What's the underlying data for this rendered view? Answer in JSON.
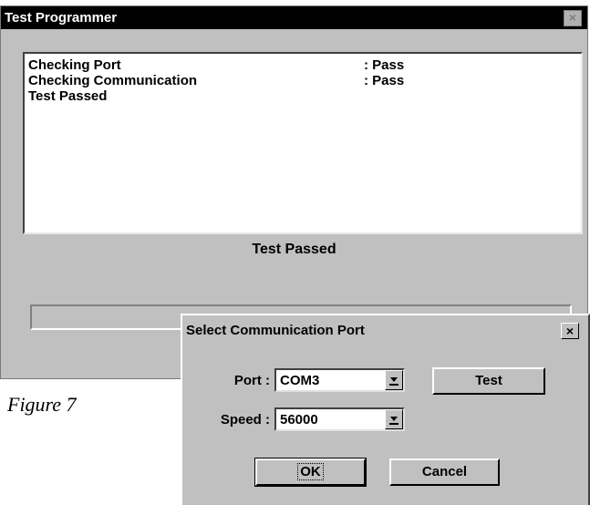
{
  "test_programmer": {
    "title": "Test Programmer",
    "close_glyph": "×",
    "log": [
      {
        "label": "Checking Port",
        "result": ": Pass"
      },
      {
        "label": "Checking Communication",
        "result": ": Pass"
      },
      {
        "label": "Test Passed",
        "result": ""
      }
    ],
    "status": "Test Passed",
    "progress": 0
  },
  "caption": "Figure 7",
  "comm_dialog": {
    "title": "Select Communication Port",
    "close_glyph": "×",
    "port_label": "Port :",
    "port_value": "COM3",
    "speed_label": "Speed :",
    "speed_value": "56000",
    "test_button": "Test",
    "ok_button": "OK",
    "cancel_button": "Cancel"
  },
  "icons": {
    "dropdown": "chevron-down-icon",
    "close": "close-icon"
  },
  "colors": {
    "titlebar": "#000000",
    "face": "#c0c0c0",
    "field": "#ffffff"
  }
}
